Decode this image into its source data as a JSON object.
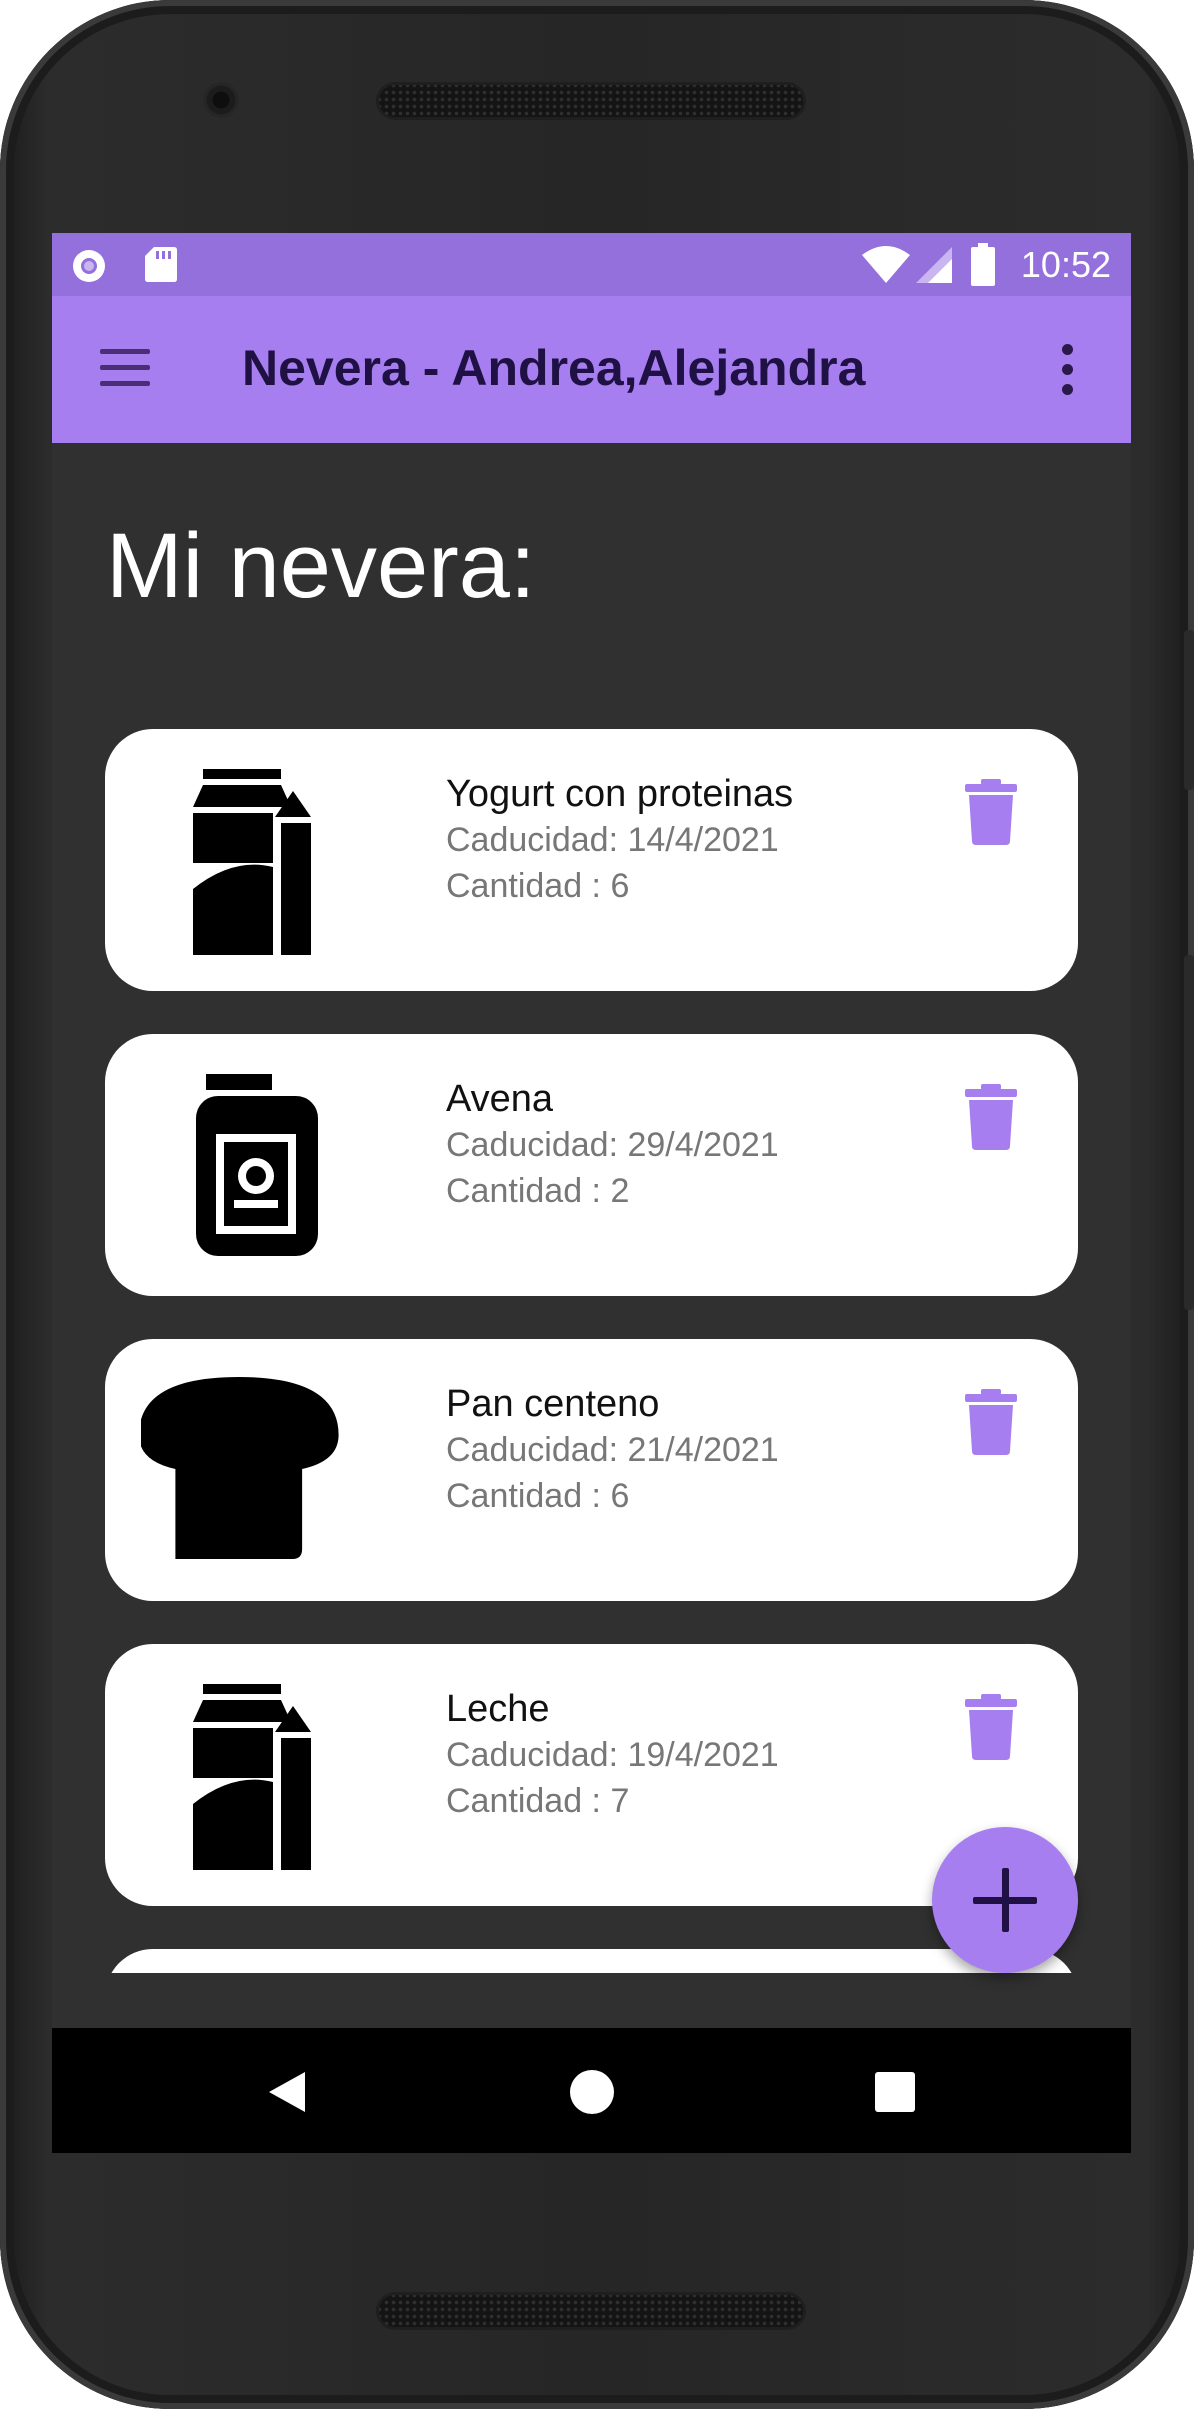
{
  "status_bar": {
    "time": "10:52",
    "icons": [
      "notification-circle-icon",
      "sd-card-icon",
      "wifi-icon",
      "signal-icon",
      "battery-icon"
    ],
    "background": "#9370db"
  },
  "app_bar": {
    "title": "Nevera - Andrea,Alejandra",
    "background": "#a67ef0",
    "menu_icon": "hamburger-menu-icon",
    "overflow_icon": "more-vert-icon"
  },
  "page": {
    "heading": "Mi nevera:",
    "background": "#303030"
  },
  "items": [
    {
      "name": "Yogurt con proteinas",
      "expiry": "Caducidad: 14/4/2021",
      "quantity": "Cantidad : 6",
      "icon": "milk-carton-icon"
    },
    {
      "name": "Avena",
      "expiry": "Caducidad: 29/4/2021",
      "quantity": "Cantidad : 2",
      "icon": "jar-icon"
    },
    {
      "name": "Pan centeno",
      "expiry": "Caducidad: 21/4/2021",
      "quantity": "Cantidad : 6",
      "icon": "bread-icon"
    },
    {
      "name": "Leche",
      "expiry": "Caducidad: 19/4/2021",
      "quantity": "Cantidad : 7",
      "icon": "milk-carton-icon"
    }
  ],
  "item_action_icon": "trash-icon",
  "accent_color": "#a67ef0",
  "fab": {
    "icon": "plus-icon"
  },
  "nav_bar": {
    "icons": [
      "back-icon",
      "home-icon",
      "recents-icon"
    ]
  }
}
